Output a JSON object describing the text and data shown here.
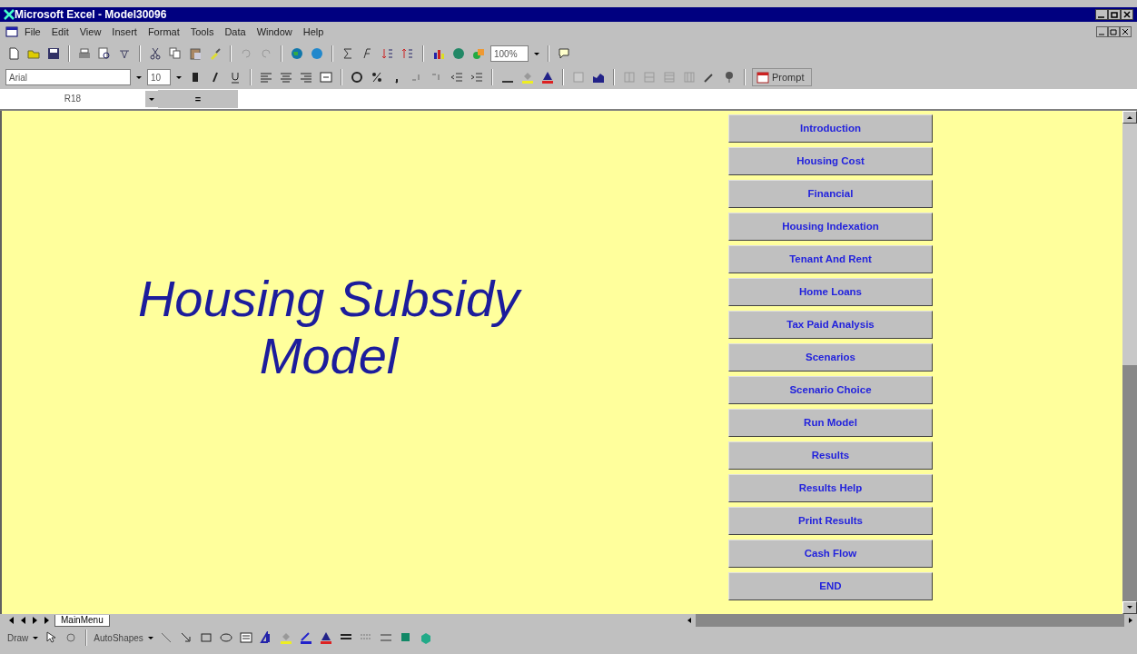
{
  "window": {
    "title": "Microsoft Excel - Model30096"
  },
  "menu": [
    {
      "label": "File"
    },
    {
      "label": "Edit"
    },
    {
      "label": "View"
    },
    {
      "label": "Insert"
    },
    {
      "label": "Format"
    },
    {
      "label": "Tools"
    },
    {
      "label": "Data"
    },
    {
      "label": "Window"
    },
    {
      "label": "Help"
    }
  ],
  "standard_toolbar": {
    "zoom": "100%"
  },
  "formatting_toolbar": {
    "font": "Arial",
    "size": "10",
    "prompt_button": "Prompt"
  },
  "formula_bar": {
    "name_box": "R18",
    "equals": "="
  },
  "sheet": {
    "heading": "Housing Subsidy Model",
    "buttons": [
      {
        "label": "Introduction"
      },
      {
        "label": "Housing Cost"
      },
      {
        "label": "Financial"
      },
      {
        "label": "Housing Indexation"
      },
      {
        "label": "Tenant And Rent"
      },
      {
        "label": "Home Loans"
      },
      {
        "label": "Tax Paid Analysis"
      },
      {
        "label": "Scenarios"
      },
      {
        "label": "Scenario Choice"
      },
      {
        "label": "Run Model"
      },
      {
        "label": "Results"
      },
      {
        "label": "Results Help"
      },
      {
        "label": "Print Results"
      },
      {
        "label": "Cash Flow"
      },
      {
        "label": "END"
      }
    ]
  },
  "sheet_tabs": [
    {
      "label": "MainMenu",
      "selected": true
    }
  ],
  "drawing_toolbar": {
    "draw": "Draw",
    "autoshapes": "AutoShapes"
  }
}
